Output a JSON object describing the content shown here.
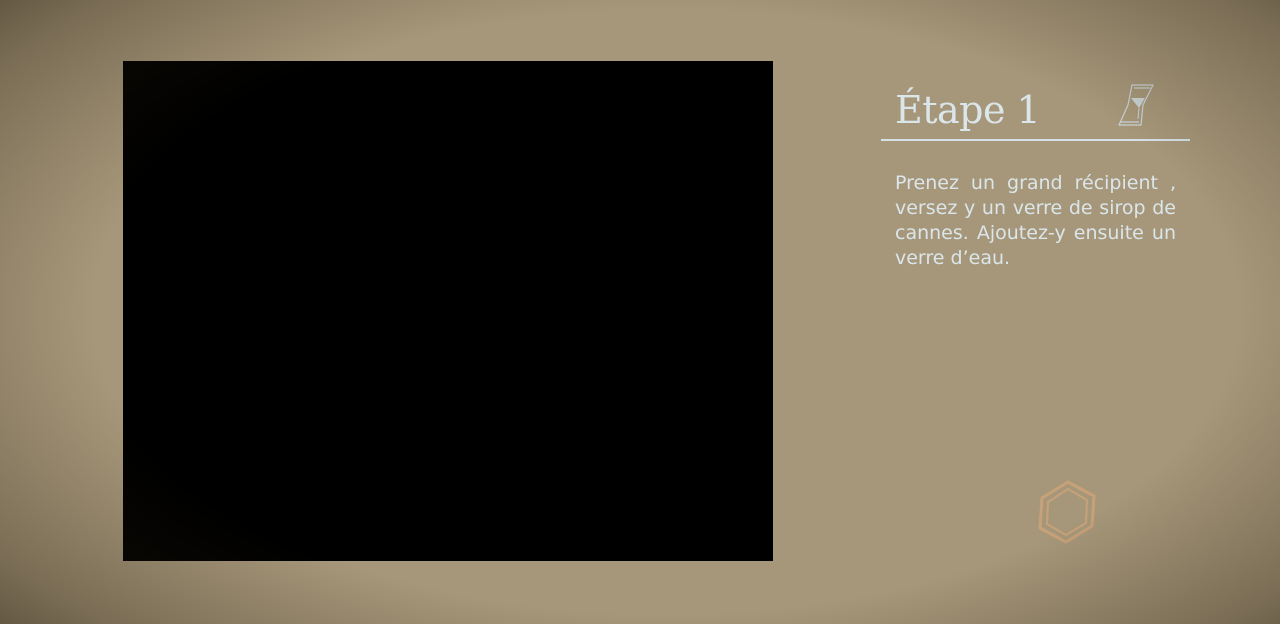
{
  "step": {
    "title": "Étape 1",
    "description": "Prenez un grand récipient , versez y un verre de sirop de cannes. Ajoutez-y ensuite un verre d’eau."
  },
  "icons": {
    "timer": "hourglass-icon",
    "decoration": "hexagon-icon"
  },
  "colors": {
    "background": "#a6977a",
    "video": "#000000",
    "text": "#dbe6ea",
    "hexagon": "#c7a178"
  }
}
